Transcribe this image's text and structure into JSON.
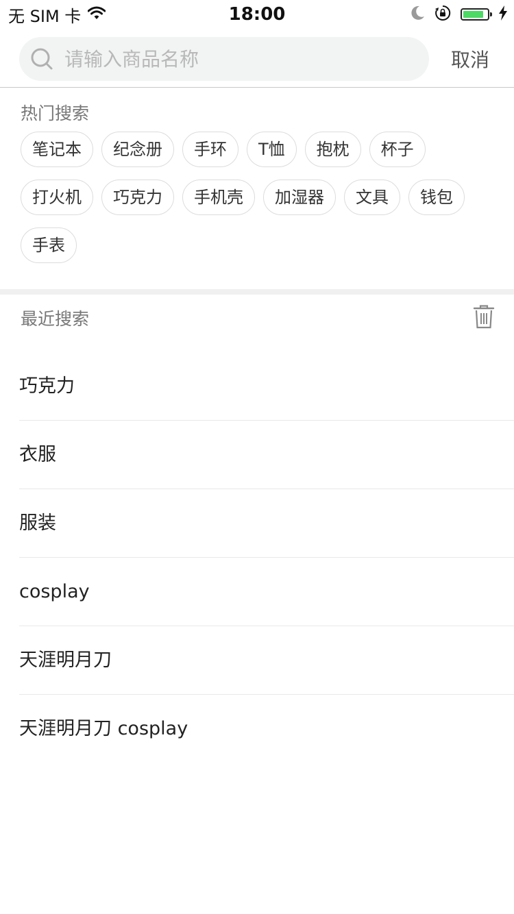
{
  "status_bar": {
    "carrier": "无 SIM 卡",
    "time": "18:00",
    "battery_level": 0.85,
    "battery_color": "#4cd964",
    "icons": [
      "wifi-icon",
      "moon-icon",
      "orientation-lock-icon",
      "battery-icon",
      "charging-icon"
    ]
  },
  "search": {
    "placeholder": "请输入商品名称",
    "value": "",
    "cancel_label": "取消",
    "icon": "search-icon"
  },
  "hot_search": {
    "title": "热门搜索",
    "tags": [
      "笔记本",
      "纪念册",
      "手环",
      "T恤",
      "抱枕",
      "杯子",
      "打火机",
      "巧克力",
      "手机壳",
      "加湿器",
      "文具",
      "钱包",
      "手表"
    ]
  },
  "recent_search": {
    "title": "最近搜索",
    "clear_icon": "trash-icon",
    "items": [
      "巧克力",
      "衣服",
      "服装",
      "cosplay",
      "天涯明月刀",
      "天涯明月刀 cosplay"
    ]
  },
  "colors": {
    "search_box_bg": "#f2f3f3",
    "section_band": "#f0f0f0",
    "tag_border": "#dcdcdc",
    "muted_text": "#777777"
  }
}
